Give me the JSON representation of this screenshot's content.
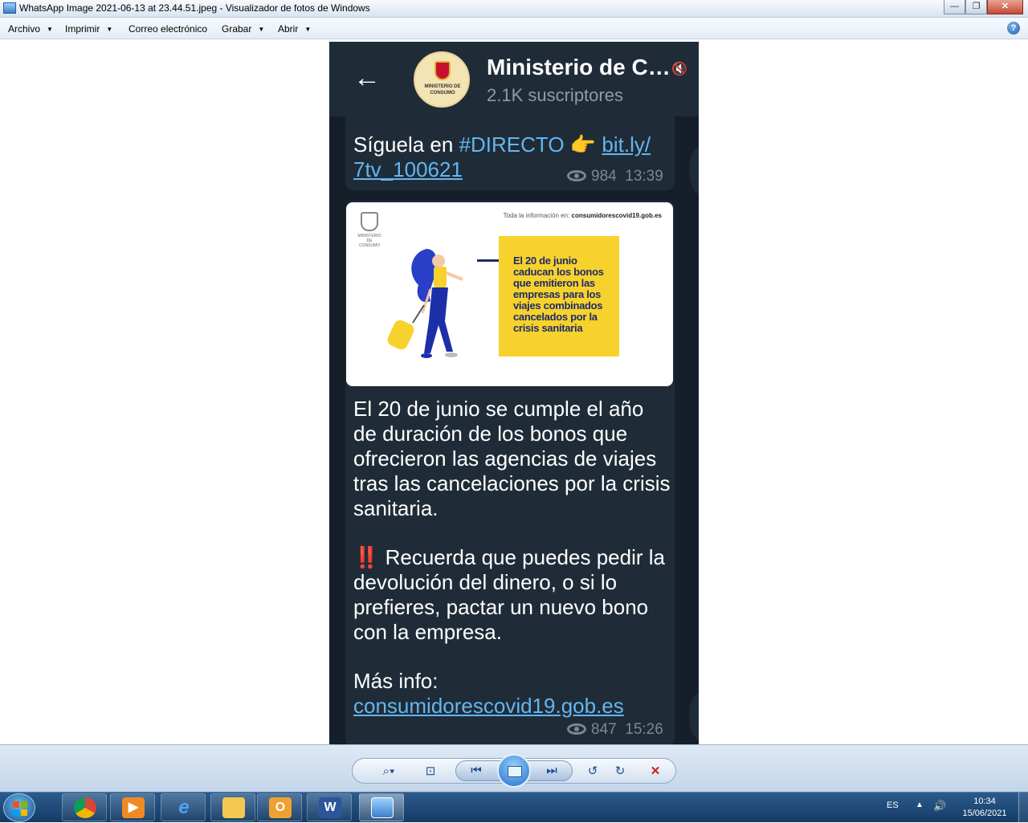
{
  "window": {
    "title": "WhatsApp Image 2021-06-13 at 23.44.51.jpeg - Visualizador de fotos de Windows",
    "minimize": "—",
    "maximize": "❐",
    "close": "✕"
  },
  "menu": {
    "archivo": "Archivo",
    "imprimir": "Imprimir",
    "correo": "Correo electrónico",
    "grabar": "Grabar",
    "abrir": "Abrir",
    "help": "?"
  },
  "telegram": {
    "back": "←",
    "avatar_label": "MINISTERIO DE CONSUMO",
    "channel_name": "Ministerio de C…",
    "subscribers": "2.1K suscriptores",
    "message1": {
      "prefix": "Síguela en ",
      "hashtag": "#DIRECTO",
      "emoji": "👉",
      "link_line1": "bit.ly/",
      "link_line2": "7tv_100621",
      "views": "984",
      "time": "13:39"
    },
    "infographic": {
      "top_prefix": "Toda la información en: ",
      "top_site": "consumidorescovid19.gob.es",
      "logo_label": "MINISTERIO DE CONSUMO",
      "box_text": "El 20 de junio caducan los bonos que emitieron las empresas para los viajes combinados cancelados por la crisis sanitaria"
    },
    "message2": {
      "para1": "El 20 de junio se cumple el año de duración de los bonos que ofrecieron las agencias de viajes tras las cancelaciones por la crisis sanitaria.",
      "alert_emoji": "‼️",
      "para2": "Recuerda que puedes pedir la devolución del dinero, o si lo prefieres, pactar un nuevo bono con la empresa.",
      "more_info": "Más info:",
      "link": "consumidorescovid19.gob.es",
      "views": "847",
      "time": "15:26"
    }
  },
  "toolbar": {
    "zoom": "⌕▾",
    "fit": "⊡",
    "prev": "⏮",
    "next": "⏭",
    "rotate_left": "↺",
    "rotate_right": "↻",
    "delete": "✕"
  },
  "taskbar": {
    "word_glyph": "W",
    "lang": "ES",
    "tray_arrow": "▲",
    "speaker": "🔊",
    "time": "10:34",
    "date": "15/06/2021"
  }
}
